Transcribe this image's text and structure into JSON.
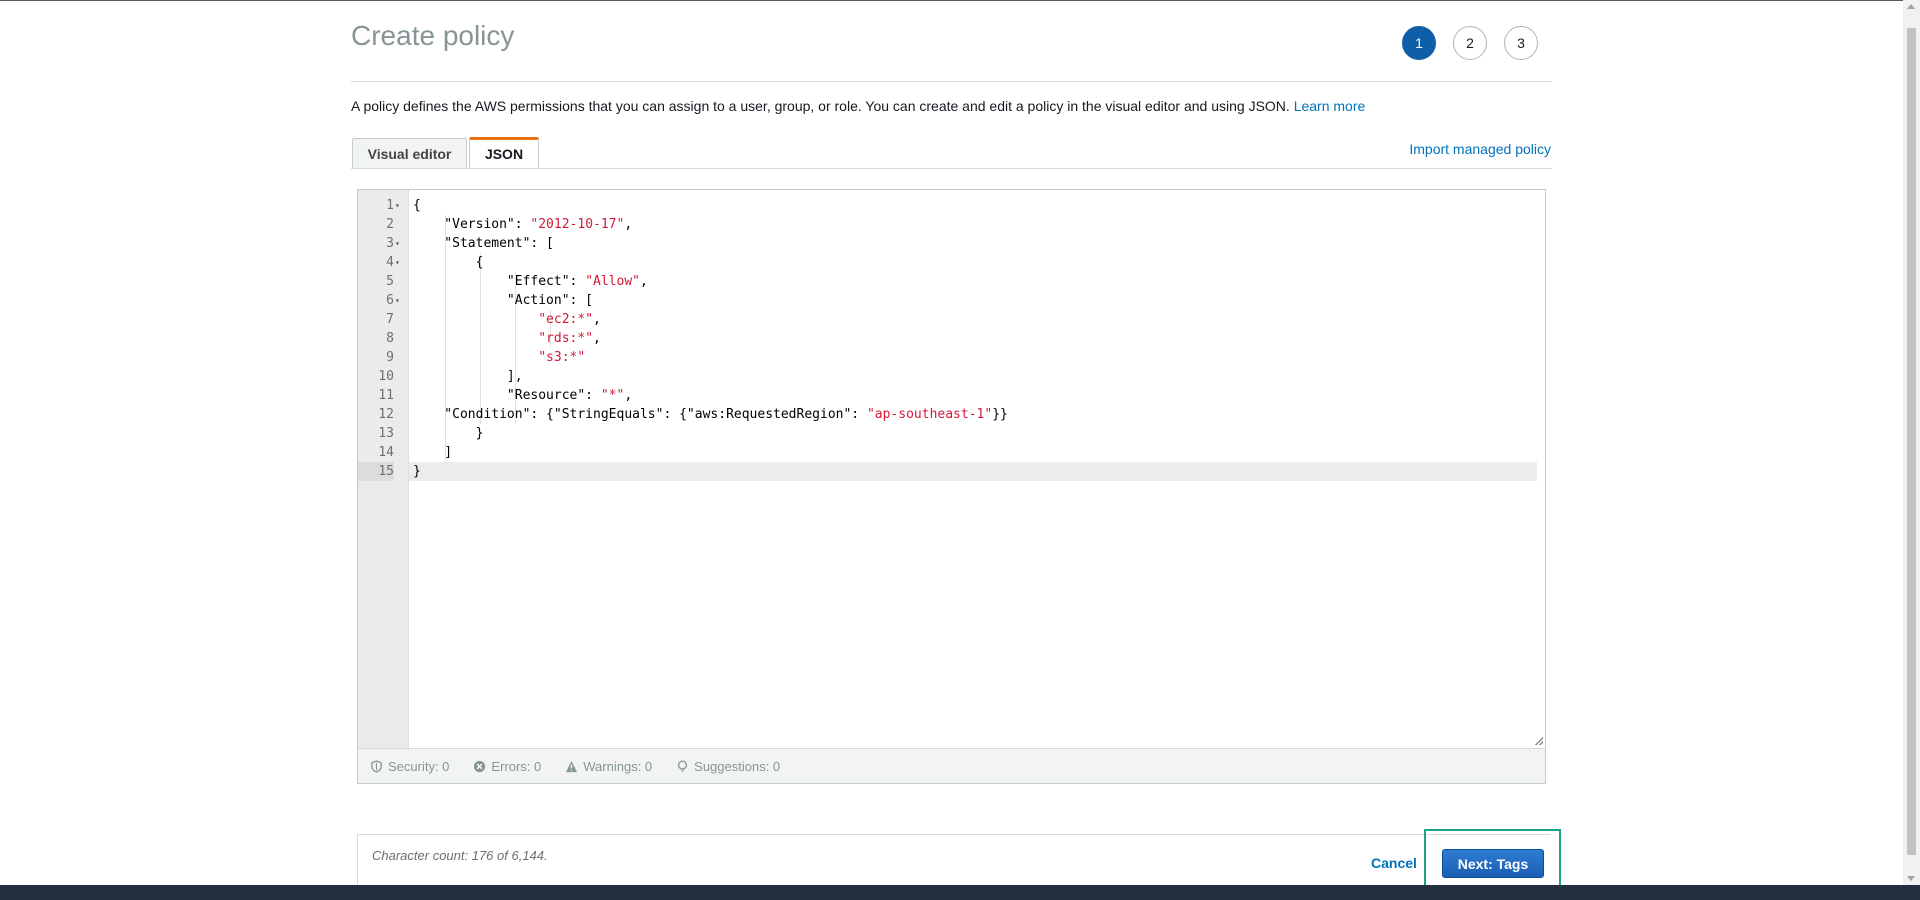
{
  "header": {
    "title": "Create policy",
    "steps": [
      "1",
      "2",
      "3"
    ],
    "active_step": "1"
  },
  "description": {
    "text": "A policy defines the AWS permissions that you can assign to a user, group, or role. You can create and edit a policy in the visual editor and using JSON. ",
    "learn_more": "Learn more"
  },
  "tabs": [
    {
      "label": "Visual editor",
      "active": false
    },
    {
      "label": "JSON",
      "active": true
    }
  ],
  "import_link": "Import managed policy",
  "editor": {
    "lines": [
      {
        "n": "1",
        "fold": true
      },
      {
        "n": "2",
        "fold": false
      },
      {
        "n": "3",
        "fold": true
      },
      {
        "n": "4",
        "fold": true
      },
      {
        "n": "5",
        "fold": false
      },
      {
        "n": "6",
        "fold": true
      },
      {
        "n": "7",
        "fold": false
      },
      {
        "n": "8",
        "fold": false
      },
      {
        "n": "9",
        "fold": false
      },
      {
        "n": "10",
        "fold": false
      },
      {
        "n": "11",
        "fold": false
      },
      {
        "n": "12",
        "fold": false
      },
      {
        "n": "13",
        "fold": false
      },
      {
        "n": "14",
        "fold": false
      },
      {
        "n": "15",
        "fold": false
      }
    ],
    "code": [
      "{",
      "    \"Version\": ",
      "\"2012-10-17\"",
      ",",
      "    \"Statement\": [",
      "        {",
      "            \"Effect\": ",
      "\"Allow\"",
      ",",
      "            \"Action\": [",
      "                ",
      "\"ec2:*\"",
      ",",
      "                ",
      "\"rds:*\"",
      ",",
      "                ",
      "\"s3:*\"",
      "            ],",
      "            \"Resource\": ",
      "\"*\"",
      ",",
      "    \"Condition\": {\"StringEquals\": {\"aws:RequestedRegion\": ",
      "\"ap-southeast-1\"",
      "}}",
      "        }",
      "    ]",
      "}"
    ],
    "status": {
      "security": "Security: 0",
      "errors": "Errors: 0",
      "warnings": "Warnings: 0",
      "suggestions": "Suggestions: 0"
    }
  },
  "footer": {
    "char_count": "Character count: 176 of 6,144.",
    "cancel": "Cancel",
    "next": "Next: Tags"
  },
  "colors": {
    "accent": "#0f5ea8",
    "tab_active": "#ec7211",
    "string": "#d11a3a",
    "highlight": "#1aa589"
  }
}
